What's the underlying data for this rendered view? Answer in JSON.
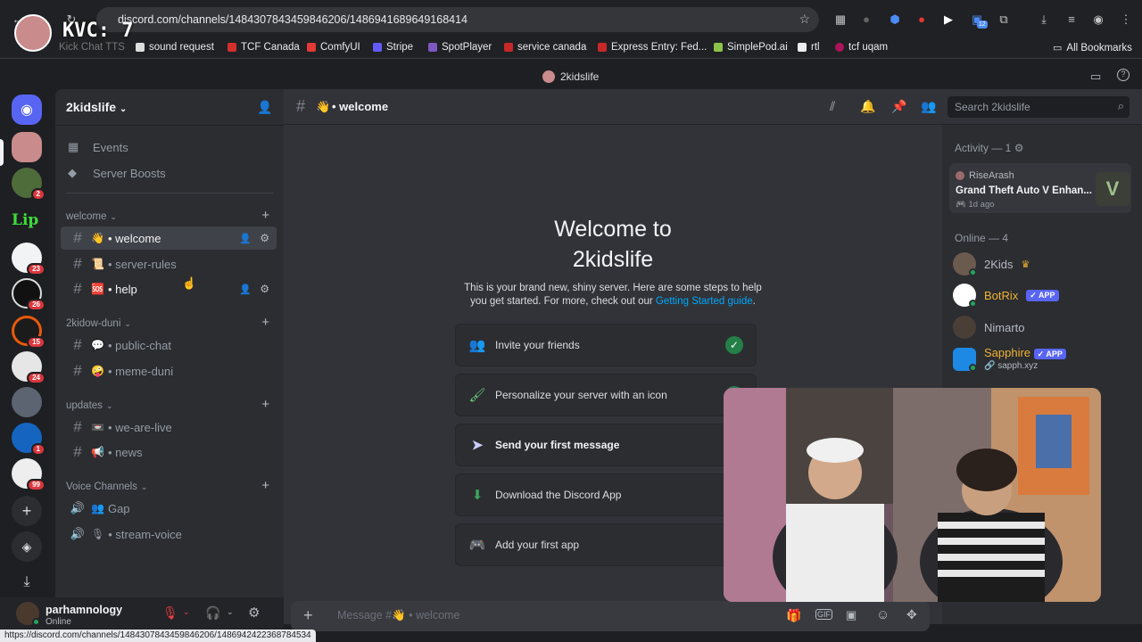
{
  "browser": {
    "url": "discord.com/channels/1484307843459846206/1486941689649168414",
    "status_url": "https://discord.com/channels/1484307843459846206/1486942422368784534",
    "bookmarks": [
      "Kick Chat TTS",
      "sound request",
      "TCF Canada",
      "ComfyUI",
      "Stripe",
      "SpotPlayer",
      "service canada",
      "Express Entry: Fed...",
      "SimplePod.ai",
      "rtl",
      "tcf uqam"
    ],
    "all_bookmarks": "All Bookmarks",
    "extension_badge": "12"
  },
  "overlay": {
    "kvc_label": "KVC: 7"
  },
  "discord": {
    "window_title": "2kidslife",
    "rail_badges": [
      "2",
      "23",
      "26",
      "15",
      "24",
      "1",
      "99"
    ],
    "rail_logo_text": "Lip",
    "server_name": "2kidslife",
    "top_items": [
      "Events",
      "Server Boosts"
    ],
    "categories": [
      {
        "name": "welcome",
        "channels": [
          {
            "emoji": "👋",
            "name": "welcome",
            "active": true
          },
          {
            "emoji": "📜",
            "name": "server-rules",
            "active": false
          },
          {
            "emoji": "🆘",
            "name": "help",
            "active": false
          }
        ]
      },
      {
        "name": "2kidow-duni",
        "channels": [
          {
            "emoji": "💬",
            "name": "public-chat"
          },
          {
            "emoji": "🤪",
            "name": "meme-duni"
          }
        ]
      },
      {
        "name": "updates",
        "channels": [
          {
            "emoji": "📼",
            "name": "we-are-live"
          },
          {
            "emoji": "📢",
            "name": "news"
          }
        ]
      },
      {
        "name": "Voice Channels",
        "channels": [
          {
            "emoji": "👥",
            "name": "Gap"
          },
          {
            "emoji": "🎙",
            "name": "stream-voice"
          }
        ]
      }
    ],
    "channel_header": {
      "emoji": "👋",
      "name": "welcome"
    },
    "search_placeholder": "Search 2kidslife",
    "welcome": {
      "title_line1": "Welcome to",
      "title_line2": "2kidslife",
      "desc_line1": "This is your brand new, shiny server. Here are some steps to help",
      "desc_line2": "you get started. For more, check out our",
      "link": "Getting Started guide",
      "link_end": "."
    },
    "tasks": [
      {
        "label": "Invite your friends",
        "done": true,
        "icon": "invite-icon"
      },
      {
        "label": "Personalize your server with an icon",
        "done": true,
        "icon": "personalize-icon"
      },
      {
        "label": "Send your first message",
        "done": false,
        "icon": "send-icon"
      },
      {
        "label": "Download the Discord App",
        "done": false,
        "icon": "download-icon"
      },
      {
        "label": "Add your first app",
        "done": false,
        "icon": "controller-icon"
      }
    ],
    "composer_placeholder_prefix": "Message #",
    "composer_placeholder_emoji": "👋",
    "composer_placeholder_name": "• welcome",
    "activity": {
      "header": "Activity — 1",
      "user": "RiseArash",
      "game": "Grand Theft Auto V Enhan...",
      "time": "1d ago"
    },
    "online_header": "Online — 4",
    "members": [
      {
        "name": "2Kids",
        "color": "#b5bac1",
        "crown": true,
        "app": false,
        "sub": ""
      },
      {
        "name": "BotRix",
        "color": "#f0b232",
        "crown": false,
        "app": true,
        "sub": ""
      },
      {
        "name": "Nimarto",
        "color": "#b5bac1",
        "crown": false,
        "app": false,
        "sub": ""
      },
      {
        "name": "Sapphire",
        "color": "#f0b232",
        "crown": false,
        "app": true,
        "sub": "sapph.xyz"
      }
    ],
    "app_badge": "✓ APP",
    "user": {
      "name": "parhamnology",
      "status": "Online"
    }
  }
}
